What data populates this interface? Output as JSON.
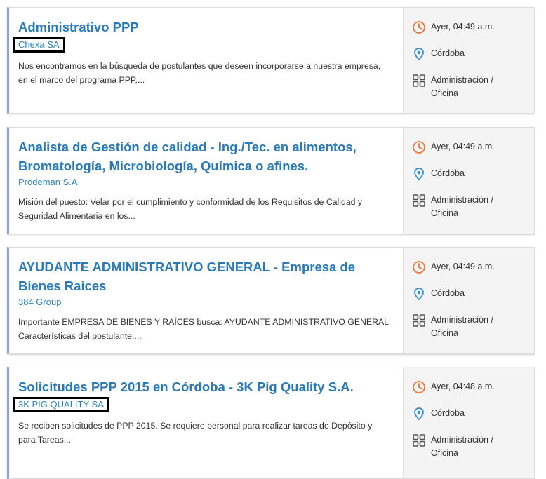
{
  "jobs": [
    {
      "title": "Administrativo PPP",
      "company": "Chexa SA",
      "description": "Nos encontramos en la búsqueda de postulantes que deseen incorporarse a nuestra empresa, en el marco del programa PPP,...",
      "time": "Ayer, 04:49 a.m.",
      "location": "Córdoba",
      "category_line1": "Administración /",
      "category_line2": "Oficina"
    },
    {
      "title": "Analista de Gestión de calidad - Ing./Tec. en alimentos, Bromatología, Microbiología, Química o afines.",
      "company": "Prodeman S.A",
      "description": "Misión del puesto: Velar por el cumplimiento y conformidad de los Requisitos de Calidad y Seguridad Alimentaria en los...",
      "time": "Ayer, 04:49 a.m.",
      "location": "Córdoba",
      "category_line1": "Administración /",
      "category_line2": "Oficina"
    },
    {
      "title": "AYUDANTE ADMINISTRATIVO GENERAL - Empresa de Bienes Raices",
      "company": "384 Group",
      "description": "Importante EMPRESA DE BIENES Y RAÍCES busca: AYUDANTE ADMINISTRATIVO GENERAL Características del postulante:...",
      "time": "Ayer, 04:49 a.m.",
      "location": "Córdoba",
      "category_line1": "Administración /",
      "category_line2": "Oficina"
    },
    {
      "title": "Solicitudes PPP 2015 en Córdoba - 3K Pig Quality S.A.",
      "company": "3K PIG QUALITY SA",
      "description": "Se reciben solicitudes de PPP 2015. Se requiere personal para realizar tareas de Depósito y para Tareas...",
      "time": "Ayer, 04:48 a.m.",
      "location": "Córdoba",
      "category_line1": "Administración /",
      "category_line2": "Oficina"
    }
  ],
  "icons": {
    "time": "clock-icon",
    "location": "location-pin-icon",
    "category": "grid-category-icon"
  },
  "colors": {
    "title": "#2a7ab7",
    "company": "#2d83c2",
    "clock": "#e8793a",
    "pin": "#3d8fd0",
    "grid": "#555555"
  }
}
